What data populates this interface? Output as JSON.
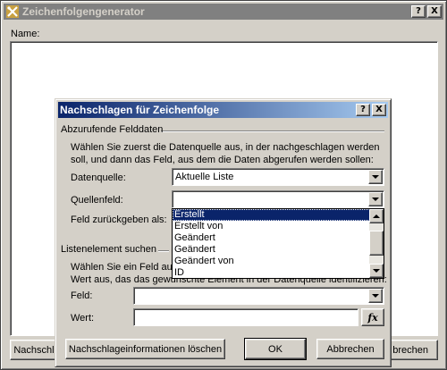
{
  "main_window": {
    "title": "Zeichenfolgengenerator",
    "help_button": "?",
    "close_button": "X",
    "name_label": "Name:",
    "left_button": "Nachschla",
    "right_button": "brechen"
  },
  "dialog": {
    "title": "Nachschlagen für Zeichenfolge",
    "help_button": "?",
    "close_button": "X",
    "group1_label": "Abzurufende Felddaten",
    "group1_text_line1": "Wählen Sie zuerst die Datenquelle aus, in der nachgeschlagen werden",
    "group1_text_line2": "soll, und dann das Feld, aus dem die Daten abgerufen werden sollen:",
    "datasource_label": "Datenquelle:",
    "datasource_value": "Aktuelle Liste",
    "sourcefield_label": "Quellenfeld:",
    "sourcefield_value": "",
    "return_label": "Feld zurückgeben als:",
    "group2_label": "Listenelement suchen",
    "group2_text_line1": "Wählen Sie ein Feld aus",
    "group2_text_line2": "Wert aus, das das gewünschte Element in der Datenquelle identifizieren:",
    "field_label": "Feld:",
    "field_value": "",
    "value_label": "Wert:",
    "value_value": "",
    "fx_button": "fx",
    "clear_button": "Nachschlageinformationen löschen",
    "ok_button": "OK",
    "cancel_button": "Abbrechen",
    "dropdown_items": [
      "Erstellt",
      "Erstellt von",
      "Geändert",
      "Geändert",
      "Geändert von",
      "ID"
    ],
    "dropdown_selected": "Erstellt"
  },
  "colors": {
    "inactive_titlebar": "#808080",
    "active_titlebar_start": "#0a246a",
    "active_titlebar_end": "#a6caf0",
    "face": "#d4d0c8",
    "selection": "#0a246a"
  }
}
